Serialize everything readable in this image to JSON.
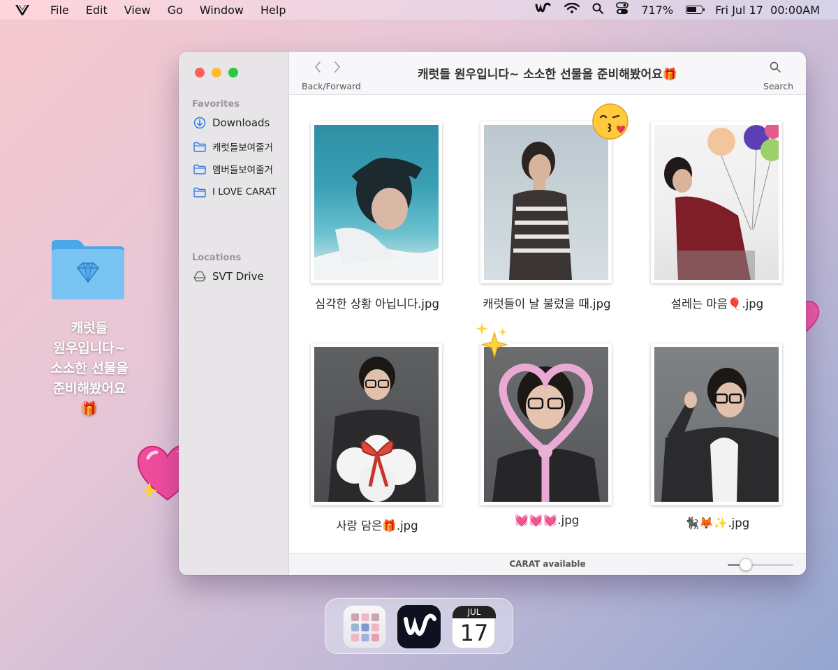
{
  "menubar": {
    "items": [
      "File",
      "Edit",
      "View",
      "Go",
      "Window",
      "Help"
    ],
    "battery_percent": "717%",
    "battery_level": 0.7,
    "datetime": "Fri Jul 17  00:00AM"
  },
  "desktop": {
    "folder_label": "캐럿들\n원우입니다~\n소소한 선물을\n준비해봤어요\n🎁"
  },
  "window": {
    "title": "캐럿들 원우입니다~ 소소한 선물을 준비해봤어요🎁",
    "nav_label": "Back/Forward",
    "search_label": "Search",
    "sidebar": {
      "favorites_title": "Favorites",
      "favorites": [
        "Downloads",
        "캐럿들보여줄거",
        "멤버들보여줄거",
        "I LOVE CARAT"
      ],
      "locations_title": "Locations",
      "locations": [
        "SVT Drive"
      ]
    },
    "files": [
      {
        "name": "심각한 상황 아닙니다.jpg"
      },
      {
        "name": "캐럿들이 날 불렀을 때.jpg"
      },
      {
        "name": "설레는 마음🎈.jpg"
      },
      {
        "name": "사랑 담은🎁.jpg"
      },
      {
        "name": "💓💓💓.jpg"
      },
      {
        "name": "🐈‍⬛🦊✨.jpg"
      }
    ],
    "status_text": "CARAT available",
    "zoom_level": 0.28
  },
  "dock": {
    "calendar_month": "JUL",
    "calendar_day": "17"
  },
  "colors": {
    "close": "#ff5f57",
    "minimize": "#febc2e",
    "zoom": "#28c840",
    "accent": "#2f7be5"
  }
}
